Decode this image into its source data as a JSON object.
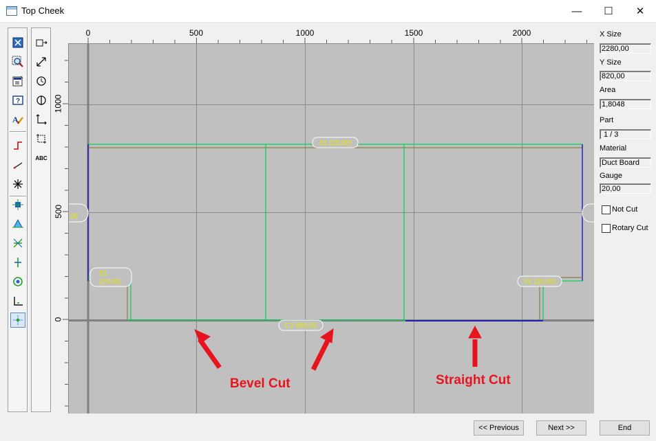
{
  "window": {
    "title": "Top Cheek",
    "minimize_glyph": "—",
    "maximize_glyph": "☐",
    "close_glyph": "✕"
  },
  "toolbar_left": [
    "fit-view-icon",
    "zoom-window-icon",
    "properties-icon",
    "help-icon",
    "text-style-icon",
    "step-line-icon",
    "diagonal-line-icon",
    "cross-icon",
    "node-blue-icon",
    "node-triangle-icon",
    "intersect-icon",
    "vertical-node-icon",
    "circle-node-icon",
    "corner-icon",
    "snap-point-icon"
  ],
  "toolbar_right": [
    "resize-horizontal-icon",
    "resize-diagonal-icon",
    "rotate-clockwise-icon",
    "rotate-vertical-icon",
    "axis-icon",
    "dimension-icon",
    "abc-text-icon"
  ],
  "abc_label": "ABC",
  "ruler": {
    "x_labels": [
      "0",
      "500",
      "1000",
      "1500",
      "2000"
    ],
    "y_labels": [
      "1000",
      "500",
      "0"
    ]
  },
  "drawing": {
    "labels": {
      "top_seam": "S1 (20,00)",
      "left_seam_1": "S1",
      "left_seam_2": "(20,00)",
      "right_seam": "S1 (20,00)",
      "bottom_cut": "C2 600,00",
      "left_edge": "00"
    },
    "colors": {
      "green": "#00d05a",
      "blue": "#0000c8",
      "olive": "#8a8040",
      "label_text": "#e8e800",
      "annotation": "#e8141d"
    }
  },
  "annotations": {
    "bevel_cut": "Bevel Cut",
    "straight_cut": "Straight Cut"
  },
  "properties": {
    "x_size_label": "X Size",
    "x_size_value": "2280,00",
    "y_size_label": "Y Size",
    "y_size_value": "820,00",
    "area_label": "Area",
    "area_value": "1,8048",
    "part_label": "Part",
    "part_value": "1 / 3",
    "material_label": "Material",
    "material_value": "Duct Board",
    "gauge_label": "Gauge",
    "gauge_value": "20,00",
    "not_cut_label": "Not Cut",
    "rotary_cut_label": "Rotary Cut"
  },
  "buttons": {
    "previous": "<< Previous",
    "next": "Next >>",
    "end": "End"
  }
}
